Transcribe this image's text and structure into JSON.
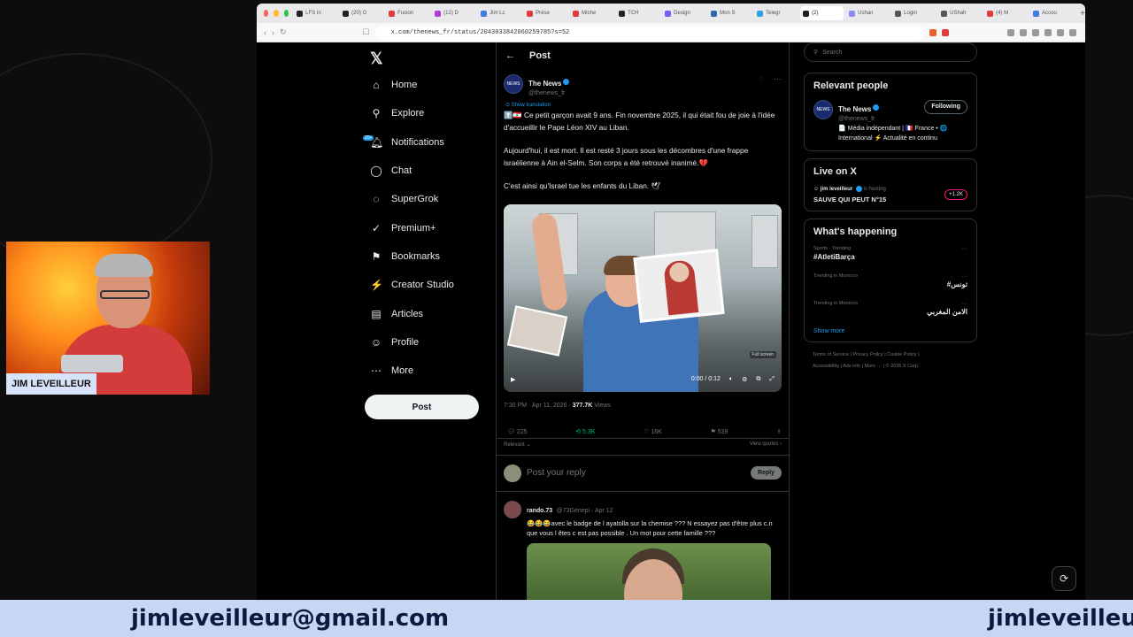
{
  "browser": {
    "tabs": [
      {
        "label": "LFS In",
        "color": "#222"
      },
      {
        "label": "(20) O",
        "color": "#222"
      },
      {
        "label": "Fusion",
        "color": "#e23b3b"
      },
      {
        "label": "(12) D",
        "color": "#b23ad6"
      },
      {
        "label": "Jim Lc",
        "color": "#3a7ee2"
      },
      {
        "label": "Prése",
        "color": "#e23b3b"
      },
      {
        "label": "Miche",
        "color": "#e23b3b"
      },
      {
        "label": "TCH",
        "color": "#222"
      },
      {
        "label": "Design",
        "color": "#7a5af8"
      },
      {
        "label": "Mon S",
        "color": "#2f6aa8"
      },
      {
        "label": "Telegr",
        "color": "#2aa3e0"
      },
      {
        "label": "(2)",
        "color": "#222",
        "active": true
      },
      {
        "label": "Ushan",
        "color": "#8a8af0"
      },
      {
        "label": "Login",
        "color": "#555"
      },
      {
        "label": "UShah",
        "color": "#555"
      },
      {
        "label": "(4) M",
        "color": "#e23b3b"
      },
      {
        "label": "Accou",
        "color": "#3a7ee2"
      }
    ],
    "url": "x.com/thenews_fr/status/2043033842060259785?s=52"
  },
  "nav": {
    "items": [
      {
        "label": "Home",
        "icon": "⌂"
      },
      {
        "label": "Explore",
        "icon": "⚲"
      },
      {
        "label": "Notifications",
        "icon": "🔔︎"
      },
      {
        "label": "Chat",
        "icon": "◯"
      },
      {
        "label": "SuperGrok",
        "icon": "◌"
      },
      {
        "label": "Premium+",
        "icon": "✓"
      },
      {
        "label": "Bookmarks",
        "icon": "⚑"
      },
      {
        "label": "Creator Studio",
        "icon": "⚡"
      },
      {
        "label": "Articles",
        "icon": "▤"
      },
      {
        "label": "Profile",
        "icon": "☺"
      },
      {
        "label": "More",
        "icon": "⋯"
      }
    ],
    "notif_badge": "20+",
    "post_button": "Post"
  },
  "post": {
    "header": "Post",
    "author_name": "The News",
    "author_handle": "@thenews_fr",
    "show_translation": "Show translation",
    "text": [
      "⬆️🇱🇧 Ce petit garçon avait 9 ans. Fin novembre 2025, il qui était fou de joie à l'idée d'accueillir le Pape Léon XIV au Liban.",
      "Aujourd'hui, il est mort. Il est resté 3 jours sous les décombres d'une frappe israélienne à Ain el-Selm. Son corps a été retrouvé inanimé.💔",
      "C'est ainsi qu'Israel tue les enfants du Liban. 🕊"
    ],
    "video_time": "0:00 / 0:12",
    "video_badge": "Full screen",
    "timestamp": "7:30 PM · Apr 11, 2026 · ",
    "views_count": "377.7K",
    "views_label": "Views",
    "replies": "225",
    "reposts": "5.3K",
    "likes": "16K",
    "bookmarks": "539",
    "relevant": "Relevant ⌄",
    "view_quotes": "View quotes ›",
    "reply_placeholder": "Post your reply",
    "reply_button": "Reply"
  },
  "comment": {
    "name": "rando.73",
    "handle": "@73Genepi · Apr 12",
    "text": "😂😂😂avec le badge de l ayatolla sur la chemise ??? N essayez pas d'être plus c.n que vous l êtes c est pas possible . Un mot pour cette famille ???"
  },
  "sidebar": {
    "search_placeholder": "Search",
    "relevant_title": "Relevant people",
    "rp_name": "The News",
    "rp_handle": "@thenews_fr",
    "rp_follow": "Following",
    "rp_bio": "📄 Média indépendant | 🇫🇷 France • 🌐 International ⚡ Actualité en continu",
    "live_title": "Live on X",
    "live_host": "jim leveilleur",
    "live_hosting": "is hosting",
    "live_name": "SAUVE QUI PEUT N°15",
    "live_count": "+1.2K",
    "happening_title": "What's happening",
    "trends": [
      {
        "cat": "Sports · Trending",
        "name": "#AtletiBarça",
        "rtl": false
      },
      {
        "cat": "Trending in Morocco",
        "name": "#تونس",
        "rtl": true
      },
      {
        "cat": "Trending in Morocco",
        "name": "الامن المغربي",
        "rtl": true
      }
    ],
    "show_more": "Show more",
    "footer_line1": "Terms of Service  |  Privacy Policy  |  Cookie Policy  |",
    "footer_line2": "Accessibility  |  Ads info  |  More ···  |  © 2026 X Corp."
  },
  "webcam": {
    "name": "JIM LEVEILLEUR"
  },
  "banner": {
    "email": "jimleveilleur@gmail.com"
  },
  "colors": {
    "accent": "#1d9bf0",
    "repost": "#00ba7c",
    "banner_bg": "#c7d6f3"
  }
}
